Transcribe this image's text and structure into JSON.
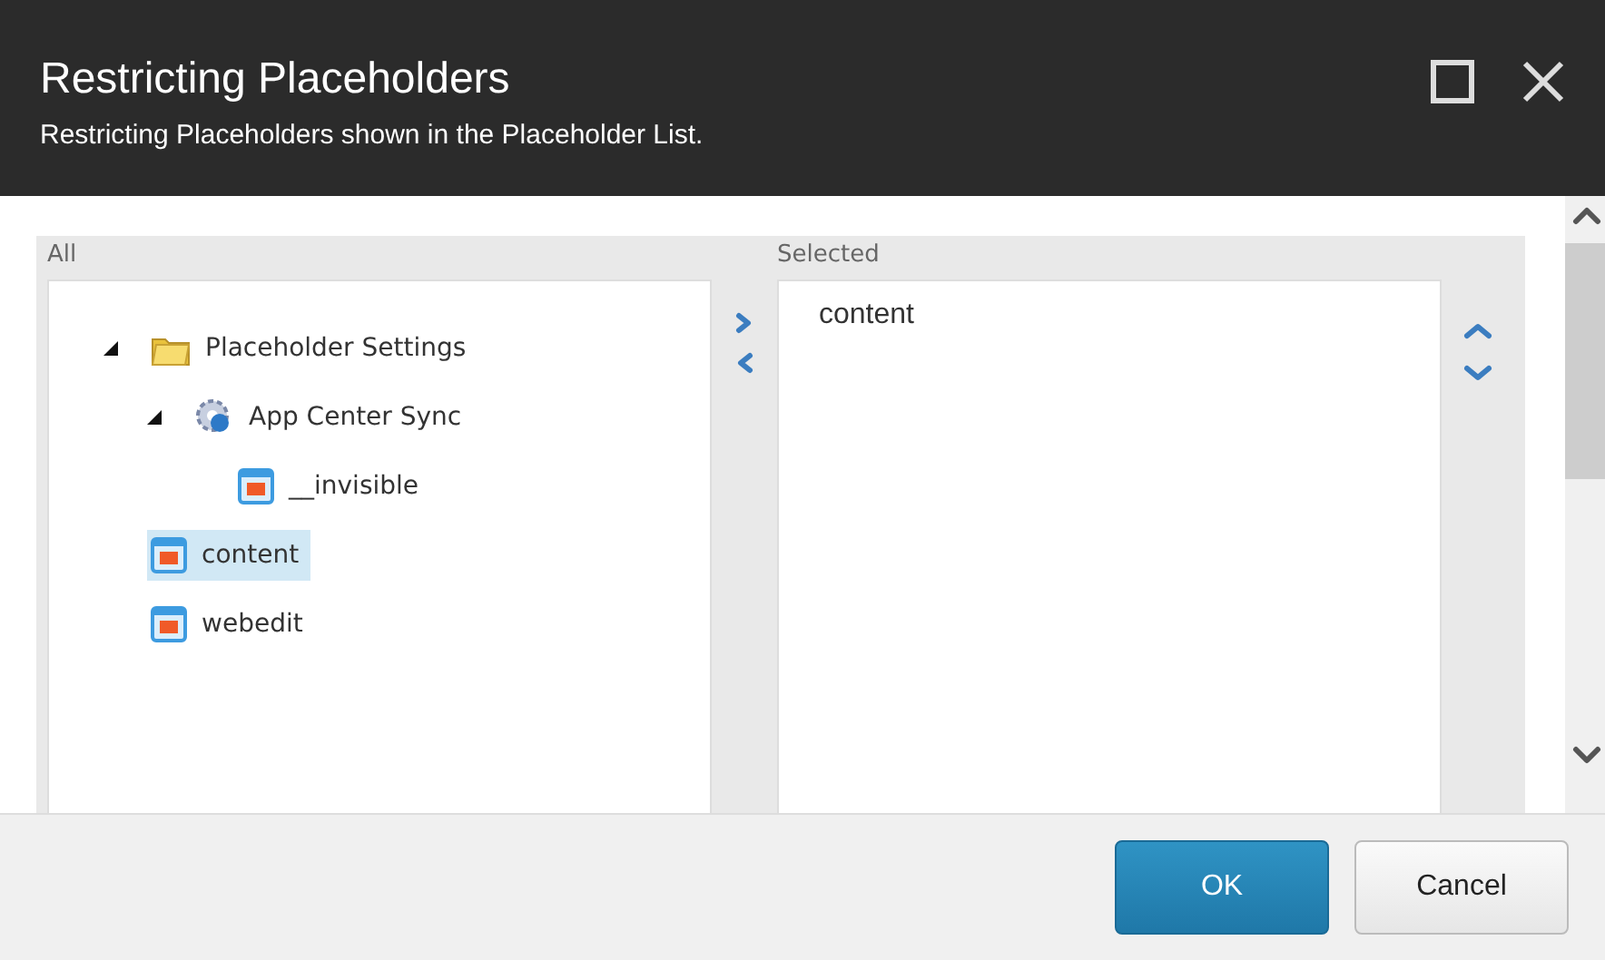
{
  "window": {
    "title": "Restricting Placeholders",
    "subtitle": "Restricting Placeholders shown in the Placeholder List."
  },
  "all": {
    "label": "All",
    "tree": [
      {
        "label": "Placeholder Settings",
        "kind": "folder",
        "expanded": true,
        "selected": false,
        "children": [
          {
            "label": "App Center Sync",
            "kind": "gear",
            "expanded": true,
            "selected": false,
            "children": [
              {
                "label": "__invisible",
                "kind": "placeholder",
                "selected": false
              }
            ]
          }
        ]
      },
      {
        "label": "content",
        "kind": "placeholder",
        "selected": true
      },
      {
        "label": "webedit",
        "kind": "placeholder",
        "selected": false
      }
    ]
  },
  "selected": {
    "label": "Selected",
    "items": [
      "content"
    ]
  },
  "buttons": [
    {
      "label": "OK",
      "kind": "primary"
    },
    {
      "label": "Cancel",
      "kind": "secondary"
    }
  ]
}
